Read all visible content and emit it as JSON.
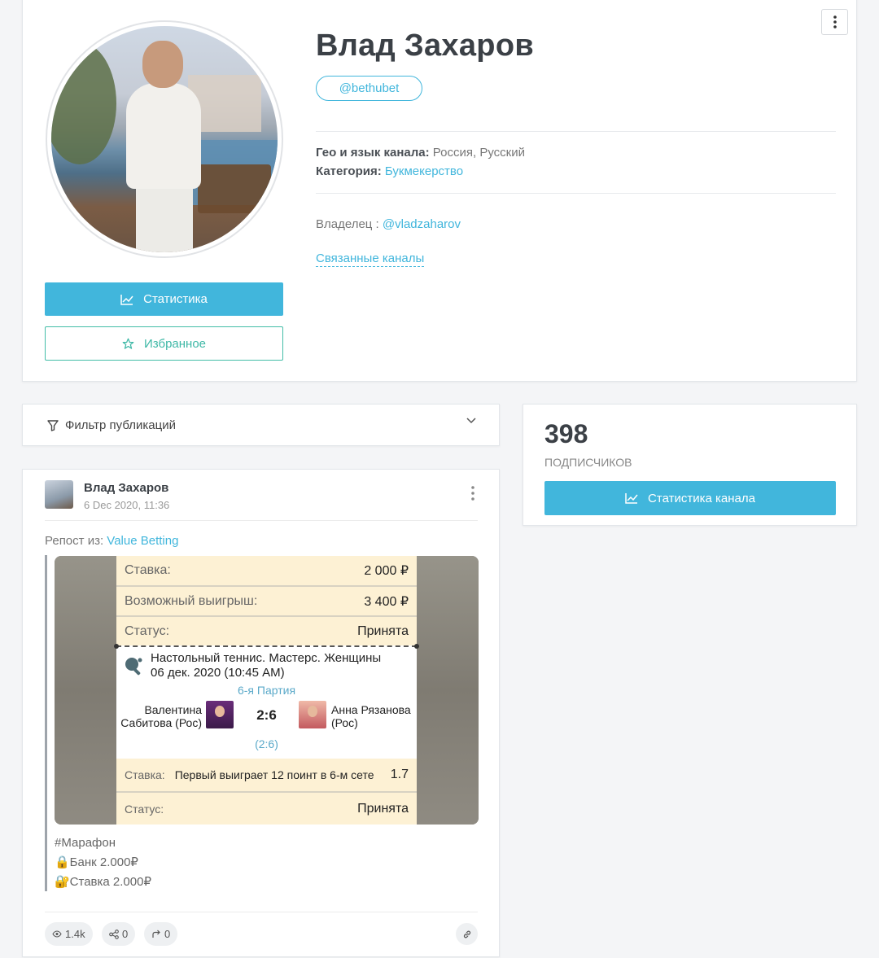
{
  "profile": {
    "name": "Влад Захаров",
    "handle": "@bethubet",
    "geo_label": "Гео и язык канала:",
    "geo_value": "Россия, Русский",
    "category_label": "Категория:",
    "category_value": "Букмекерство",
    "owner_label": "Владелец :",
    "owner_value": "@vladzaharov",
    "related_label": "Связанные каналы",
    "stats_button": "Статистика",
    "favorite_button": "Избранное"
  },
  "filter": {
    "label": "Фильтр публикаций"
  },
  "subscribers": {
    "count": "398",
    "label": "ПОДПИСЧИКОВ",
    "button": "Статистика канала"
  },
  "post": {
    "author": "Влад Захаров",
    "date": "6 Dec 2020, 11:36",
    "repost_label": "Репост из:",
    "repost_source": "Value Betting",
    "bet": {
      "stake_label": "Ставка:",
      "stake_value": "2 000 ₽",
      "win_label": "Возможный выигрыш:",
      "win_value": "3 400 ₽",
      "status_label": "Статус:",
      "status_value": "Принята",
      "match_line1": "Настольный теннис. Мастерс. Женщины",
      "match_line2": "06 дек. 2020 (10:45 AM)",
      "part": "6-я Партия",
      "player1_line1": "Валентина",
      "player1_line2": "Сабитова (Рос)",
      "player2_line1": "Анна Рязанова",
      "player2_line2": "(Рос)",
      "score": "2:6",
      "subscore": "(2:6)",
      "detail_label": "Ставка:",
      "detail_text": "Первый выиграет 12 поинт в 6-м сете",
      "odd": "1.7",
      "status2_label": "Статус:",
      "status2_value": "Принята"
    },
    "text_lines": [
      "#Марафон",
      "🔒Банк 2.000₽",
      "🔐Ставка 2.000₽"
    ],
    "views": "1.4k",
    "shares": "0",
    "forwards": "0"
  }
}
